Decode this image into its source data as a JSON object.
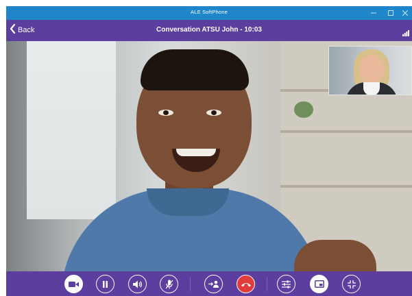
{
  "window": {
    "title": "ALE SoftPhone"
  },
  "nav": {
    "back_label": "Back",
    "conversation_title": "Conversation ATSU John - 10:03"
  },
  "icons": {
    "minimize": "minimize-icon",
    "maximize": "maximize-icon",
    "close": "close-icon",
    "back": "chevron-left-icon",
    "signal": "signal-bars-icon"
  },
  "controls": [
    {
      "name": "video-button",
      "icon": "video-camera-icon",
      "filled": true
    },
    {
      "name": "hold-button",
      "icon": "pause-icon",
      "filled": false
    },
    {
      "name": "speaker-button",
      "icon": "speaker-icon",
      "filled": false
    },
    {
      "name": "mute-button",
      "icon": "microphone-off-icon",
      "filled": false
    },
    {
      "name": "transfer-button",
      "icon": "transfer-user-icon",
      "filled": false
    },
    {
      "name": "hangup-button",
      "icon": "hangup-phone-icon",
      "filled": true
    },
    {
      "name": "settings-button",
      "icon": "sliders-icon",
      "filled": false
    },
    {
      "name": "pip-toggle-button",
      "icon": "picture-in-picture-icon",
      "filled": true
    },
    {
      "name": "exit-fullscreen-button",
      "icon": "collapse-icon",
      "filled": false
    }
  ],
  "colors": {
    "titlebar": "#1f86c9",
    "accent": "#5b3e9e",
    "hangup": "#e23b3b"
  }
}
